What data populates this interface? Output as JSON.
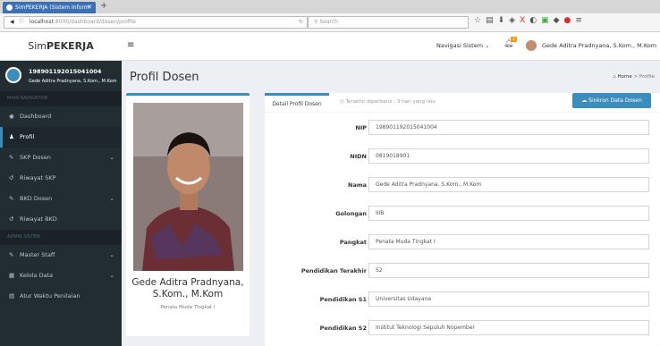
{
  "browser": {
    "tab_title": "SimPEKERJA (Sistem Inform",
    "url_host": "localhost",
    "url_path": ":8000/dashboard/dosen/profile",
    "search_placeholder": "Search"
  },
  "app": {
    "brand_prefix": "Sim",
    "brand_bold": "PEKERJA"
  },
  "sidebar": {
    "user_nip": "198901192015041004",
    "user_name": "Gede Aditra Pradnyana, S.Kom., M.Kom",
    "main_header": "MAIN NAVIGATION",
    "admin_header": "ADMIN SISTEM",
    "items": [
      {
        "label": "Dashboard",
        "icon": "dashboard-icon"
      },
      {
        "label": "Profil",
        "icon": "user-icon"
      },
      {
        "label": "SKP Dosen",
        "icon": "edit-icon"
      },
      {
        "label": "Riwayat SKP",
        "icon": "history-icon"
      },
      {
        "label": "BKD Dosen",
        "icon": "edit-icon"
      },
      {
        "label": "Riwayat BKD",
        "icon": "history-icon"
      }
    ],
    "admin_items": [
      {
        "label": "Master Staff",
        "icon": "edit-icon"
      },
      {
        "label": "Kelola Data",
        "icon": "table-icon"
      },
      {
        "label": "Atur Waktu Penilaian",
        "icon": "calendar-icon"
      }
    ]
  },
  "topbar": {
    "nav_system": "Navigasi Sistem",
    "badge": "1",
    "user_name": "Gede Aditra Pradnyana, S.Kom., M.Kom"
  },
  "page": {
    "title": "Profil Dosen",
    "crumb_home": "Home",
    "crumb_current": "Profile"
  },
  "profile": {
    "name": "Gede Aditra Pradnyana, S.Kom., M.Kom",
    "rank": "Penata Muda Tingkat I"
  },
  "detail": {
    "tab_label": "Detail Profil Dosen",
    "updated_text": "Terakhir diperbarui : 3 hari yang lalu",
    "sync_button": "Sinkron Data Dosen",
    "fields": [
      {
        "label": "NIP",
        "value": "198901192015041004"
      },
      {
        "label": "NIDN",
        "value": "0819018901"
      },
      {
        "label": "Nama",
        "value": "Gede Aditra Pradnyana, S.Kom., M.Kom"
      },
      {
        "label": "Golongan",
        "value": "IIIB"
      },
      {
        "label": "Pangkat",
        "value": "Penata Muda Tingkat I"
      },
      {
        "label": "Pendidikan Terakhir",
        "value": "S2"
      },
      {
        "label": "Pendidikan S1",
        "value": "Universitas Udayana"
      },
      {
        "label": "Pendidikan S2",
        "value": "Institut Teknologi Sepuluh Nopember"
      }
    ]
  }
}
